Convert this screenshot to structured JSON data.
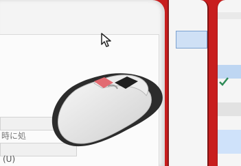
{
  "left_panel": {
    "text_1": "時に処",
    "text_2": "(U)"
  },
  "icons": {
    "pointer": "arrow-pointer-icon",
    "mouse": "mouse-icon",
    "check": "check-icon"
  }
}
